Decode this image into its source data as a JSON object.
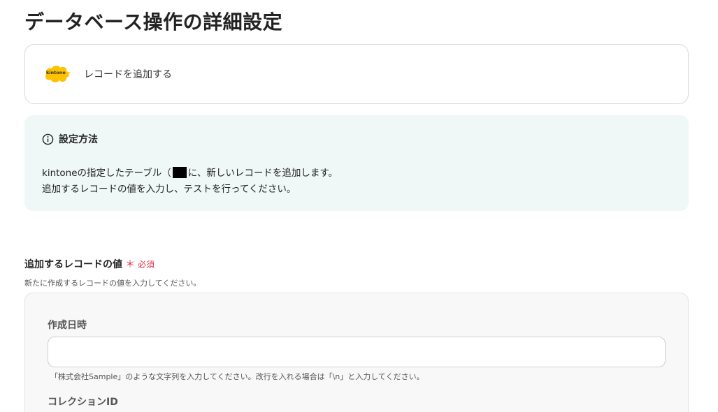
{
  "page": {
    "title": "データベース操作の詳細設定"
  },
  "action": {
    "app_logo_icon": "kintone-logo-icon",
    "app_logo_text": "kintone",
    "label": "レコードを追加する"
  },
  "info": {
    "title": "設定方法",
    "line1_a": "kintoneの指定したテーブル（",
    "line1_b": "に、新しいレコードを追加します。",
    "line2": "追加するレコードの値を入力し、テストを行ってください。"
  },
  "field": {
    "label": "追加するレコードの値",
    "required_star": "＊",
    "required_text": "必須",
    "description": "新たに作成するレコードの値を入力してください。"
  },
  "subfields": [
    {
      "label": "作成日時",
      "value": "",
      "placeholder": "",
      "hint": "「株式会社Sample」のような文字列を入力してください。改行を入れる場合は「\\n」と入力してください。"
    },
    {
      "label": "コレクションID"
    }
  ],
  "colors": {
    "accent_red": "#e0344d",
    "info_bg": "#eff8f7",
    "logo_yellow": "#fdc300"
  }
}
